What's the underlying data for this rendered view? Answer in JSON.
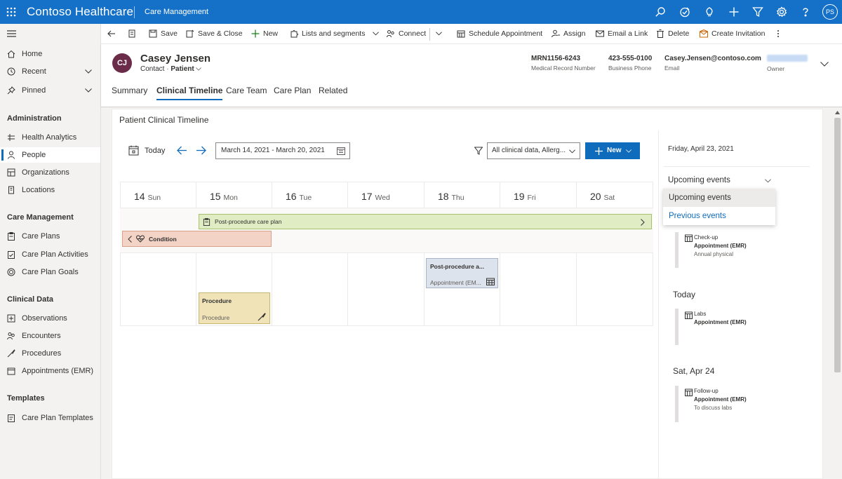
{
  "app": {
    "title": "Contoso Healthcare",
    "module": "Care Management",
    "user_initials": "PS"
  },
  "topbar_icons": [
    "search-icon",
    "task-icon",
    "lightbulb-icon",
    "plus-icon",
    "filter-icon",
    "settings-icon",
    "help-icon"
  ],
  "nav": {
    "home": "Home",
    "recent": "Recent",
    "pinned": "Pinned",
    "sections": [
      {
        "title": "Administration",
        "items": [
          "Health Analytics",
          "People",
          "Organizations",
          "Locations"
        ]
      },
      {
        "title": "Care Management",
        "items": [
          "Care Plans",
          "Care Plan Activities",
          "Care Plan Goals"
        ]
      },
      {
        "title": "Clinical Data",
        "items": [
          "Observations",
          "Encounters",
          "Procedures",
          "Appointments (EMR)"
        ]
      },
      {
        "title": "Templates",
        "items": [
          "Care Plan Templates"
        ]
      }
    ],
    "active_item": "People"
  },
  "commands": {
    "save": "Save",
    "save_close": "Save & Close",
    "new": "New",
    "lists": "Lists and segments",
    "connect": "Connect",
    "schedule": "Schedule Appointment",
    "assign": "Assign",
    "email_link": "Email a Link",
    "delete": "Delete",
    "create_invitation": "Create Invitation"
  },
  "record": {
    "initials": "CJ",
    "name": "Casey Jensen",
    "type": "Contact",
    "form": "Patient",
    "mrn": "MRN1156-6243",
    "mrn_label": "Medical Record Number",
    "phone": "423-555-0100",
    "phone_label": "Business Phone",
    "email": "Casey.Jensen@contoso.com",
    "email_label": "Email",
    "owner_label": "Owner"
  },
  "tabs": [
    "Summary",
    "Clinical Timeline",
    "Care Team",
    "Care Plan",
    "Related"
  ],
  "active_tab": "Clinical Timeline",
  "timeline": {
    "title": "Patient Clinical Timeline",
    "today": "Today",
    "date_range": "March 14, 2021 - March 20, 2021",
    "filter": "All clinical data, Allerg...",
    "new": "New",
    "days": [
      {
        "num": "14",
        "name": "Sun"
      },
      {
        "num": "15",
        "name": "Mon"
      },
      {
        "num": "16",
        "name": "Tue"
      },
      {
        "num": "17",
        "name": "Wed"
      },
      {
        "num": "18",
        "name": "Thu"
      },
      {
        "num": "19",
        "name": "Fri"
      },
      {
        "num": "20",
        "name": "Sat"
      }
    ],
    "care_plan_band": "Post-procedure care plan",
    "condition_band": "Condition",
    "appointment_card": {
      "title": "Post-procedure a...",
      "type": "Appointment (EM..."
    },
    "procedure_card": {
      "title": "Procedure",
      "type": "Procedure"
    },
    "colors": {
      "care_plan": "#dfecc4",
      "condition": "#f3d3c6",
      "appointment": "#dde3ec",
      "procedure": "#efe3b7",
      "accent": "#0f6cbd"
    }
  },
  "panel": {
    "date": "Friday, April 23, 2021",
    "selected": "Upcoming events",
    "options": [
      "Upcoming events",
      "Previous events"
    ],
    "groups": [
      {
        "heading": "",
        "title": "Check-up",
        "type": "Appointment (EMR)",
        "note": "Annual physical"
      },
      {
        "heading": "Today",
        "title": "Labs",
        "type": "Appointment (EMR)",
        "note": ""
      },
      {
        "heading": "Sat, Apr 24",
        "title": "Follow-up",
        "type": "Appointment (EMR)",
        "note": "To discuss labs"
      }
    ]
  }
}
